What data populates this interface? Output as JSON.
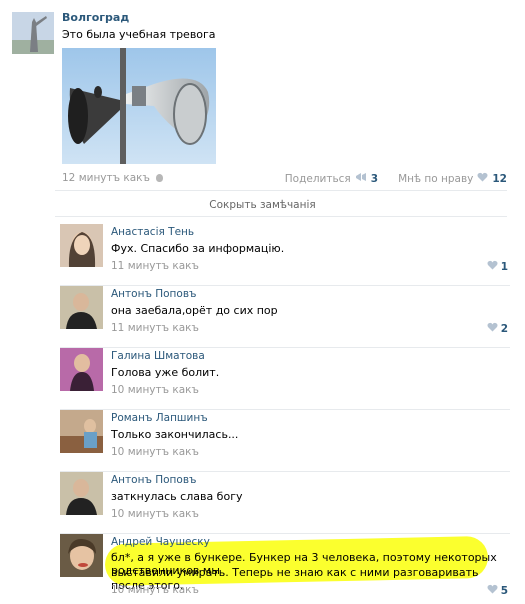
{
  "post": {
    "author": "Волгоград",
    "text": "Это была учебная тревога",
    "time": "12 минутъ какъ",
    "share_label": "Поделиться",
    "share_count": "3",
    "like_label": "Мнѣ по нраву",
    "like_count": "12",
    "hide_comments": "Сокрыть замѣчанія"
  },
  "comments": [
    {
      "name": "Анастасія Тень",
      "text": "Фух. Спасибо за информацію.",
      "time": "11 минутъ какъ",
      "likes": "1"
    },
    {
      "name": "Антонъ Поповъ",
      "text": "она заебала,орёт до сих пор",
      "time": "11 минутъ какъ",
      "likes": "2"
    },
    {
      "name": "Галина Шматова",
      "text": "Голова уже болит.",
      "time": "10 минутъ какъ",
      "likes": ""
    },
    {
      "name": "Романъ Лапшинъ",
      "text": "Только закончилась...",
      "time": "10 минутъ какъ",
      "likes": ""
    },
    {
      "name": "Антонъ Поповъ",
      "text": "заткнулась слава богу",
      "time": "10 минутъ какъ",
      "likes": ""
    },
    {
      "name": "Андрей Чаушеску",
      "text_line1": "бл*, а я уже в бункере. Бункер на 3 человека, поэтому некоторых родственников мы",
      "text_line2": "выставили умирать. Теперь не знаю как с ними разговаривать после этого.",
      "time": "10 минутъ какъ",
      "likes": "5"
    }
  ],
  "colors": {
    "link": "#2b587a",
    "highlight": "#fbff2e",
    "meta": "#999999"
  }
}
